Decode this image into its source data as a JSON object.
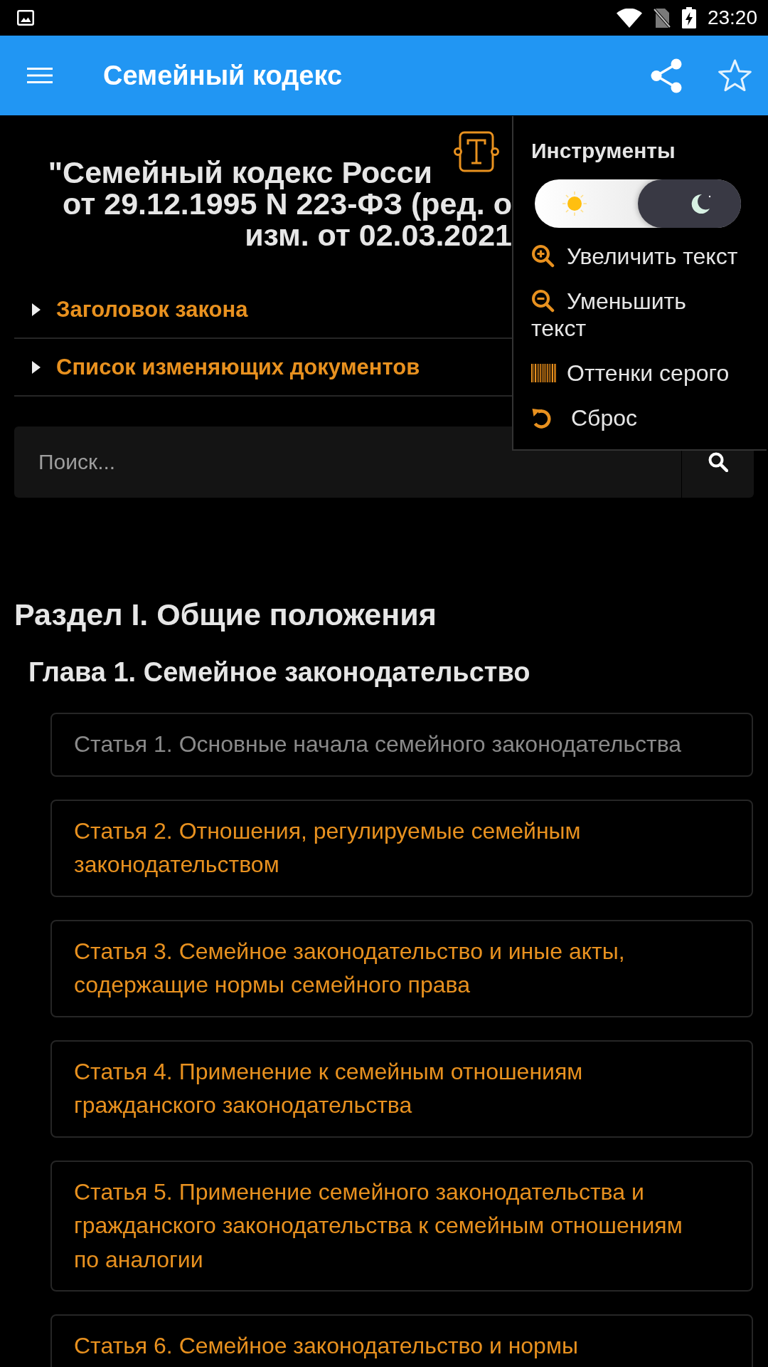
{
  "status_bar": {
    "time": "23:20"
  },
  "app_bar": {
    "title": "Семейный кодекс"
  },
  "document_title": [
    "\"Семейный кодекс Росси",
    "от 29.12.1995 N 223-ФЗ (ред. о",
    "изм. от 02.03.2021"
  ],
  "accordions": [
    {
      "label": "Заголовок закона",
      "expanded": false
    },
    {
      "label": "Список изменяющих документов",
      "expanded": false
    }
  ],
  "search": {
    "placeholder": "Поиск..."
  },
  "section": {
    "title": "Раздел I. Общие положения",
    "chapter": {
      "title": "Глава 1. Семейное законодательство",
      "articles": [
        {
          "title": "Статья 1. Основные начала семейного законодательства",
          "visited": true
        },
        {
          "title": "Статья 2. Отношения, регулируемые семейным законодательством",
          "visited": false
        },
        {
          "title": "Статья 3. Семейное законодательство и иные акты, содержащие нормы семейного права",
          "visited": false
        },
        {
          "title": "Статья 4. Применение к семейным отношениям гражданского законодательства",
          "visited": false
        },
        {
          "title": "Статья 5. Применение семейного законодательства и гражданского законодательства к семейным отношениям по аналогии",
          "visited": false
        },
        {
          "title": "Статья 6. Семейное законодательство и нормы",
          "visited": false
        }
      ]
    }
  },
  "tools_menu": {
    "title": "Инструменты",
    "theme_switch": {
      "dark": true
    },
    "items": [
      {
        "kind": "zoom-in",
        "label": "Увеличить текст"
      },
      {
        "kind": "zoom-out",
        "label": "Уменьшить текст"
      },
      {
        "kind": "grayscale",
        "label": "Оттенки серого"
      },
      {
        "kind": "reset",
        "label": "Сброс"
      }
    ]
  }
}
